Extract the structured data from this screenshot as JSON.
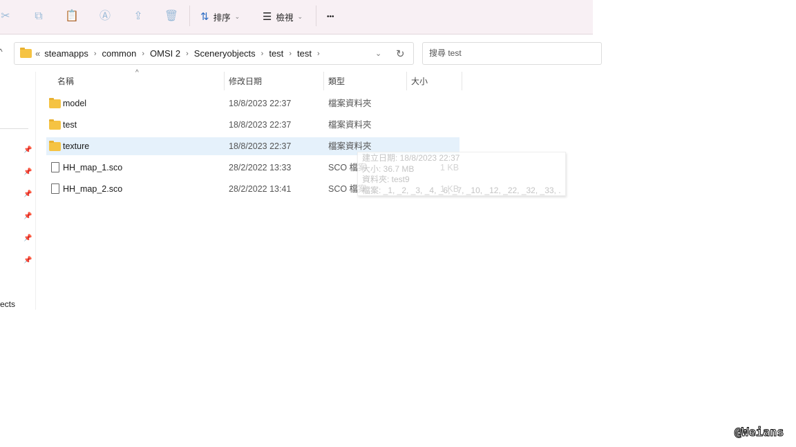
{
  "toolbar": {
    "sort_label": "排序",
    "view_label": "檢視",
    "more_label": "•••"
  },
  "address": {
    "overflow": "«",
    "crumbs": [
      "steamapps",
      "common",
      "OMSI 2",
      "Sceneryobjects",
      "test",
      "test"
    ]
  },
  "search": {
    "placeholder": "搜尋 test"
  },
  "nav": {
    "partial_label": "ects"
  },
  "columns": {
    "name": "名稱",
    "date": "修改日期",
    "type": "類型",
    "size": "大小"
  },
  "files": [
    {
      "name": "model",
      "date": "18/8/2023 22:37",
      "type": "檔案資料夾",
      "size": "",
      "kind": "folder"
    },
    {
      "name": "test",
      "date": "18/8/2023 22:37",
      "type": "檔案資料夾",
      "size": "",
      "kind": "folder"
    },
    {
      "name": "texture",
      "date": "18/8/2023 22:37",
      "type": "檔案資料夾",
      "size": "",
      "kind": "folder"
    },
    {
      "name": "HH_map_1.sco",
      "date": "28/2/2022 13:33",
      "type": "SCO 檔案",
      "size": "1 KB",
      "kind": "file"
    },
    {
      "name": "HH_map_2.sco",
      "date": "28/2/2022 13:41",
      "type": "SCO 檔案",
      "size": "1 KB",
      "kind": "file"
    }
  ],
  "tooltip": {
    "created": "建立日期: 18/8/2023 22:37",
    "size": "大小: 36.7 MB",
    "folders": "資料夾: test9",
    "files": "檔案: _1, _2, _3, _4, _6, _7, _10, _12, _22, _32, _33, ..."
  },
  "watermark": "@Weians"
}
